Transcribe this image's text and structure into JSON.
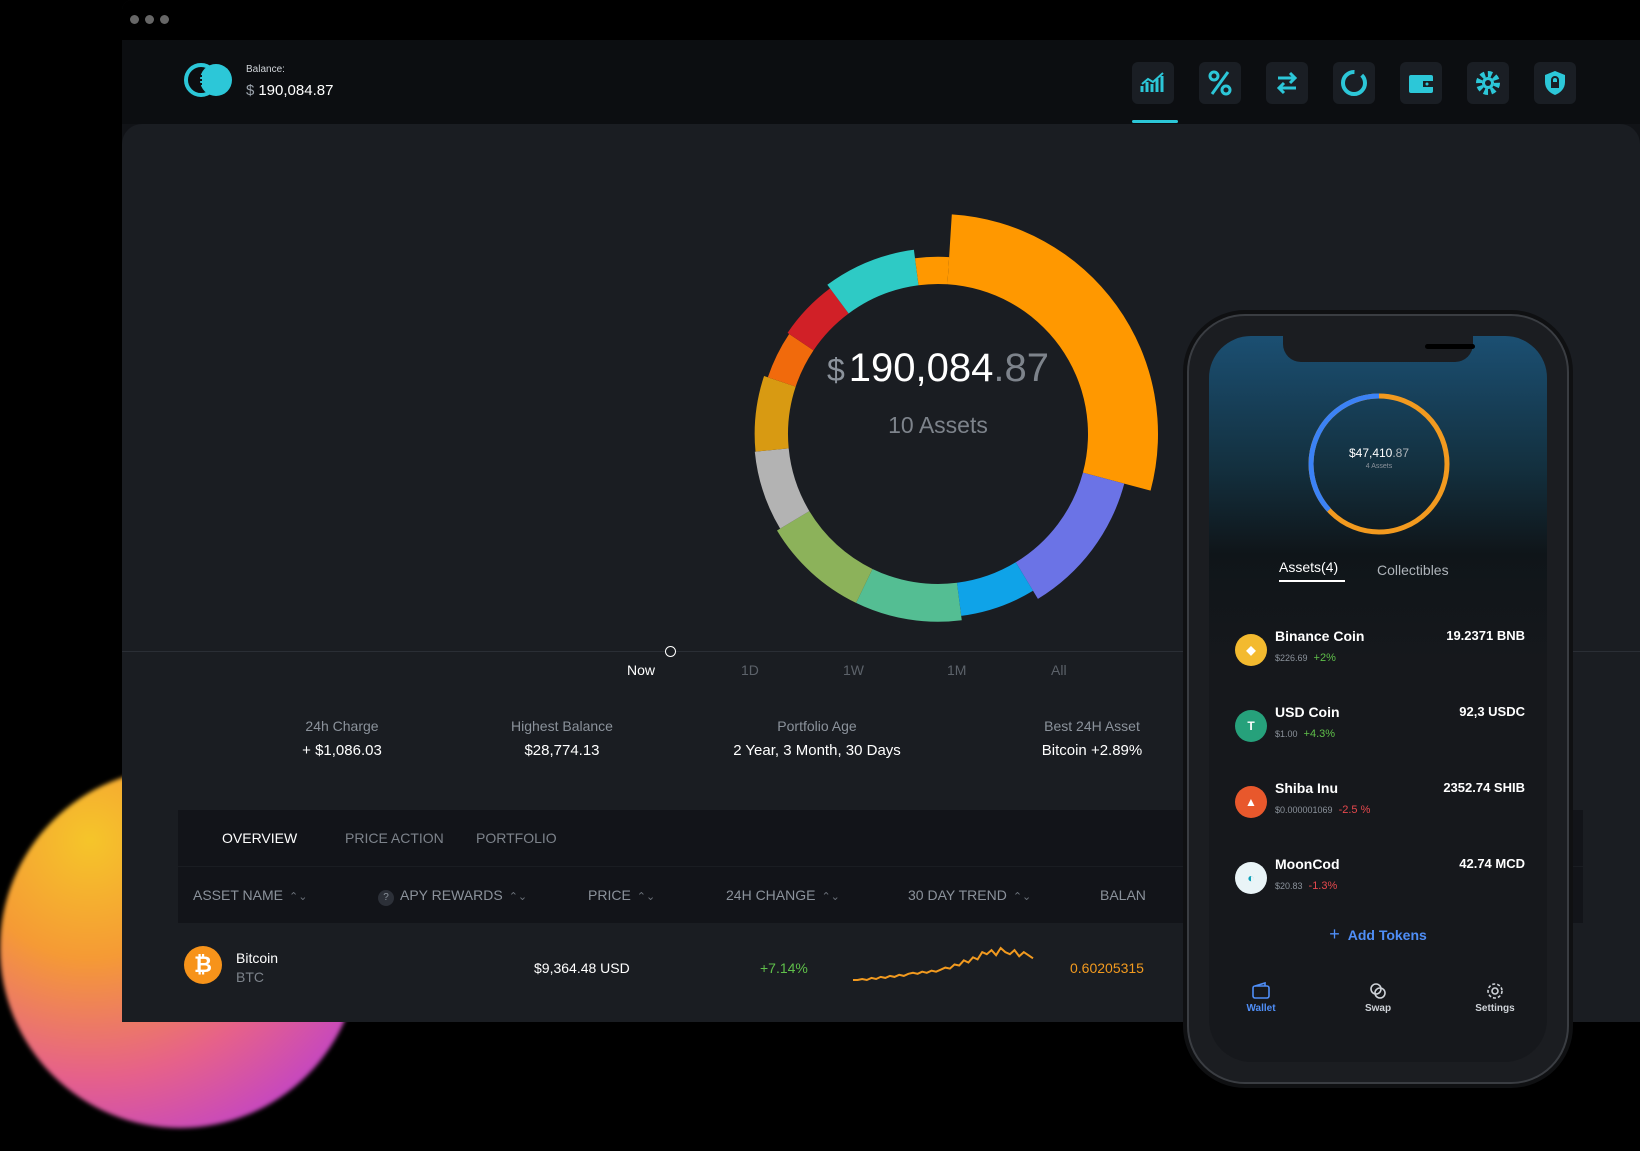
{
  "header": {
    "balance_label": "Balance:",
    "balance_currency": "$",
    "balance_value": "190,084.87",
    "nav_icons": [
      "chart-icon",
      "percent-icon",
      "swap-arrows-icon",
      "loading-ring-icon",
      "wallet-icon",
      "gear-icon",
      "shield-lock-icon"
    ],
    "accent_color": "#2cc7d8"
  },
  "portfolio": {
    "currency": "$",
    "amount_whole": "190,084",
    "amount_decimal": ".87",
    "assets_label": "10 Assets",
    "timeline": [
      "Now",
      "1D",
      "1W",
      "1M",
      "All"
    ],
    "timeline_selected": "Now"
  },
  "stats": [
    {
      "label": "24h Charge",
      "value": "+ $1,086.03"
    },
    {
      "label": "Highest Balance",
      "value": "$28,774.13"
    },
    {
      "label": "Portfolio Age",
      "value": "2 Year, 3 Month, 30 Days"
    },
    {
      "label": "Best 24H Asset",
      "value": "Bitcoin +2.89%"
    }
  ],
  "tabs": [
    "OVERVIEW",
    "PRICE ACTION",
    "PORTFOLIO"
  ],
  "table": {
    "headers": [
      "ASSET NAME",
      "APY REWARDS",
      "PRICE",
      "24H CHANGE",
      "30 DAY TREND",
      "BALAN"
    ],
    "rows": [
      {
        "name": "Bitcoin",
        "symbol": "BTC",
        "price": "$9,364.48 USD",
        "change": "+7.14%",
        "balance": "0.60205315",
        "trend": [
          3,
          3,
          4,
          3,
          5,
          4,
          6,
          5,
          7,
          6,
          8,
          7,
          9,
          10,
          9,
          11,
          10,
          12,
          11,
          13,
          15,
          14,
          18,
          17,
          22,
          20,
          25,
          23,
          30,
          28,
          32,
          27,
          34,
          30,
          28,
          32,
          26,
          30,
          27,
          24
        ]
      }
    ]
  },
  "phone": {
    "currency": "$",
    "amount_whole": "47,410",
    "amount_decimal": ".87",
    "assets_label": "4 Assets",
    "tabs": [
      "Assets(4)",
      "Collectibles"
    ],
    "tokens": [
      {
        "name": "Binance Coin",
        "qty": "19.2371 BNB",
        "price": "$226.69",
        "change": "+2%",
        "color": "#f3ba2f",
        "glyph": "◆"
      },
      {
        "name": "USD Coin",
        "qty": "92,3 USDC",
        "price": "$1.00",
        "change": "+4.3%",
        "color": "#26a17b",
        "glyph": "T"
      },
      {
        "name": "Shiba Inu",
        "qty": "2352.74 SHIB",
        "price": "$0.000001069",
        "change": "-2.5 %",
        "color": "#e8582c",
        "glyph": "🐕"
      },
      {
        "name": "MoonCod",
        "qty": "42.74 MCD",
        "price": "$20.83",
        "change": "-1.3%",
        "color": "#e9f4f7",
        "glyph": "◐"
      }
    ],
    "add_tokens": "Add Tokens",
    "nav": [
      {
        "label": "Wallet",
        "icon": "wallet-icon"
      },
      {
        "label": "Swap",
        "icon": "swap-icon"
      },
      {
        "label": "Settings",
        "icon": "settings-icon"
      }
    ]
  },
  "chart_data": {
    "type": "pie",
    "title": "",
    "categories": [
      "",
      "",
      "",
      "",
      "",
      "",
      "",
      "",
      "",
      "",
      ""
    ],
    "values": [
      27.5,
      11.9,
      6.5,
      9.0,
      9.0,
      6.9,
      6.5,
      4.2,
      5.3,
      7.9,
      3.0
    ],
    "colors": [
      "#ff9800",
      "#6b73e6",
      "#0fa3e8",
      "#54be93",
      "#8cb25a",
      "#b3b3b3",
      "#d89a12",
      "#f16a0c",
      "#d12027",
      "#2ecac5",
      "#ff9800"
    ]
  }
}
